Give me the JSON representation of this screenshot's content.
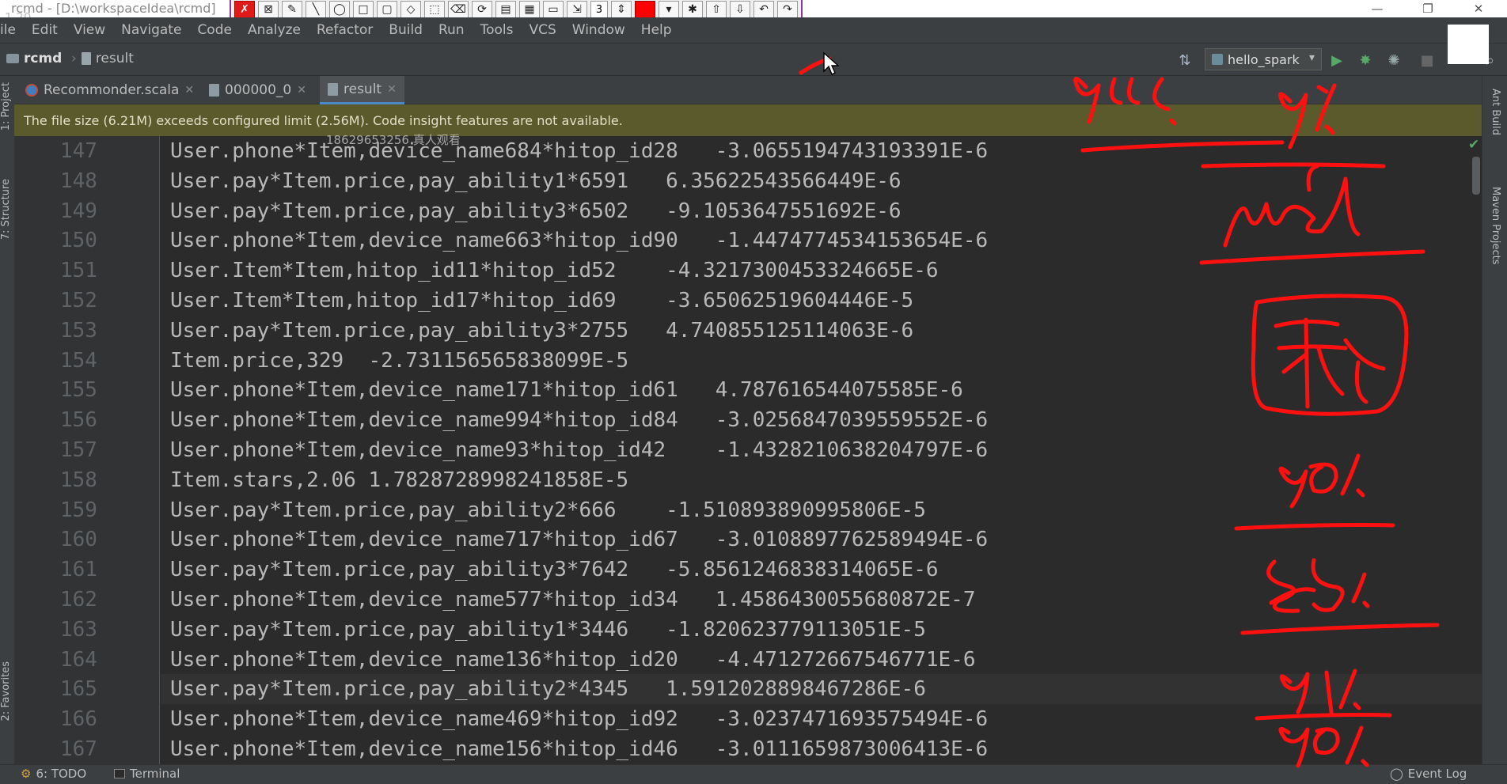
{
  "window": {
    "title": "rcmd - [D:\\workspaceIdea\\rcmd]",
    "title_overlay": "1.20",
    "draw_toolbar_number": "3"
  },
  "menu": [
    "ile",
    "Edit",
    "View",
    "Navigate",
    "Code",
    "Analyze",
    "Refactor",
    "Build",
    "Run",
    "Tools",
    "VCS",
    "Window",
    "Help"
  ],
  "breadcrumb": {
    "project": "rcmd",
    "file": "result"
  },
  "run_config": {
    "name": "hello_spark"
  },
  "tabs": [
    {
      "label": "Recommonder.scala",
      "icon": "scala-file-icon",
      "active": false
    },
    {
      "label": "000000_0",
      "icon": "text-file-icon",
      "active": false
    },
    {
      "label": "result",
      "icon": "text-file-icon",
      "active": true
    }
  ],
  "banner": "The file size (6.21M) exceeds configured limit (2.56M). Code insight features are not available.",
  "watermark": "18629653256 真人观看",
  "side_tools": {
    "left": [
      "1: Project",
      "7: Structure",
      "2: Favorites"
    ],
    "right": [
      "Ant Build",
      "Maven Projects"
    ]
  },
  "editor": {
    "current_line": "165",
    "lines": [
      {
        "num": "147",
        "text": "User.phone*Item,device_name684*hitop_id28   -3.0655194743193391E-6"
      },
      {
        "num": "148",
        "text": "User.pay*Item.price,pay_ability1*6591   6.35622543566449E-6"
      },
      {
        "num": "149",
        "text": "User.pay*Item.price,pay_ability3*6502   -9.1053647551692E-6"
      },
      {
        "num": "150",
        "text": "User.phone*Item,device_name663*hitop_id90   -1.4474774534153654E-6"
      },
      {
        "num": "151",
        "text": "User.Item*Item,hitop_id11*hitop_id52    -4.3217300453324665E-6"
      },
      {
        "num": "152",
        "text": "User.Item*Item,hitop_id17*hitop_id69    -3.65062519604446E-5"
      },
      {
        "num": "153",
        "text": "User.pay*Item.price,pay_ability3*2755   4.740855125114063E-6"
      },
      {
        "num": "154",
        "text": "Item.price,329  -2.731156565838099E-5"
      },
      {
        "num": "155",
        "text": "User.phone*Item,device_name171*hitop_id61   4.787616544075585E-6"
      },
      {
        "num": "156",
        "text": "User.phone*Item,device_name994*hitop_id84   -3.0256847039559552E-6"
      },
      {
        "num": "157",
        "text": "User.phone*Item,device_name93*hitop_id42    -1.4328210638204797E-6"
      },
      {
        "num": "158",
        "text": "Item.stars,2.06 1.7828728998241858E-5"
      },
      {
        "num": "159",
        "text": "User.pay*Item.price,pay_ability2*666    -1.510893890995806E-5"
      },
      {
        "num": "160",
        "text": "User.phone*Item,device_name717*hitop_id67   -3.0108897762589494E-6"
      },
      {
        "num": "161",
        "text": "User.pay*Item.price,pay_ability3*7642   -5.8561246838314065E-6"
      },
      {
        "num": "162",
        "text": "User.phone*Item,device_name577*hitop_id34   1.4586430055680872E-7"
      },
      {
        "num": "163",
        "text": "User.pay*Item.price,pay_ability1*3446   -1.820623779113051E-5"
      },
      {
        "num": "164",
        "text": "User.phone*Item,device_name136*hitop_id20   -4.471272667546771E-6"
      },
      {
        "num": "165",
        "text": "User.pay*Item.price,pay_ability2*4345   1.5912028898467286E-6"
      },
      {
        "num": "166",
        "text": "User.phone*Item,device_name469*hitop_id92   -3.0237471693575494E-6"
      },
      {
        "num": "167",
        "text": "User.phone*Item,device_name156*hitop_id46   -3.0111659873006413E-6"
      }
    ]
  },
  "status": {
    "todo": "6: TODO",
    "terminal": "Terminal",
    "event_log": "Event Log"
  },
  "colors": {
    "accent": "#4a88c7",
    "ink": "#ff0000",
    "banner": "#5a5a2c"
  }
}
